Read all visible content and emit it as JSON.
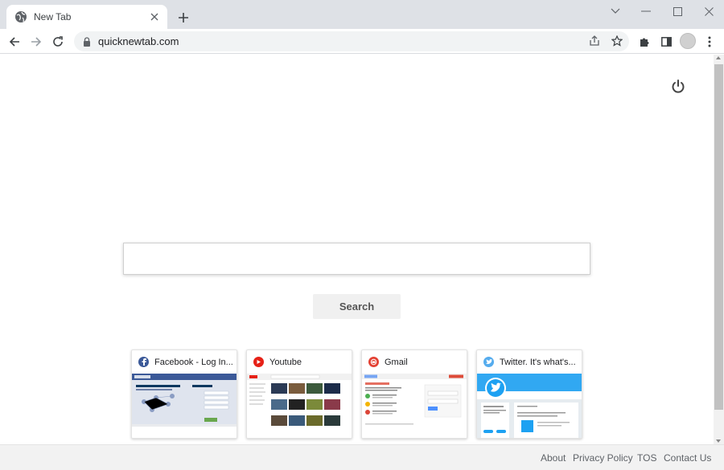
{
  "browser": {
    "tab_title": "New Tab",
    "url": "quicknewtab.com"
  },
  "search": {
    "placeholder": "",
    "button_label": "Search"
  },
  "tiles": [
    {
      "label": "Facebook - Log In...",
      "icon": "facebook-icon",
      "color": "#3b5998"
    },
    {
      "label": "Youtube",
      "icon": "youtube-icon",
      "color": "#e62117"
    },
    {
      "label": "Gmail",
      "icon": "gmail-icon",
      "color": "#e34133"
    },
    {
      "label": "Twitter. It's what's...",
      "icon": "twitter-icon",
      "color": "#55acee"
    }
  ],
  "footer": {
    "about": "About",
    "privacy": "Privacy Policy",
    "tos": "TOS",
    "contact": "Contact Us"
  },
  "colors": {
    "tabstrip": "#dee1e6",
    "omnibox": "#f1f3f4",
    "footer_bg": "#f2f2f2"
  }
}
